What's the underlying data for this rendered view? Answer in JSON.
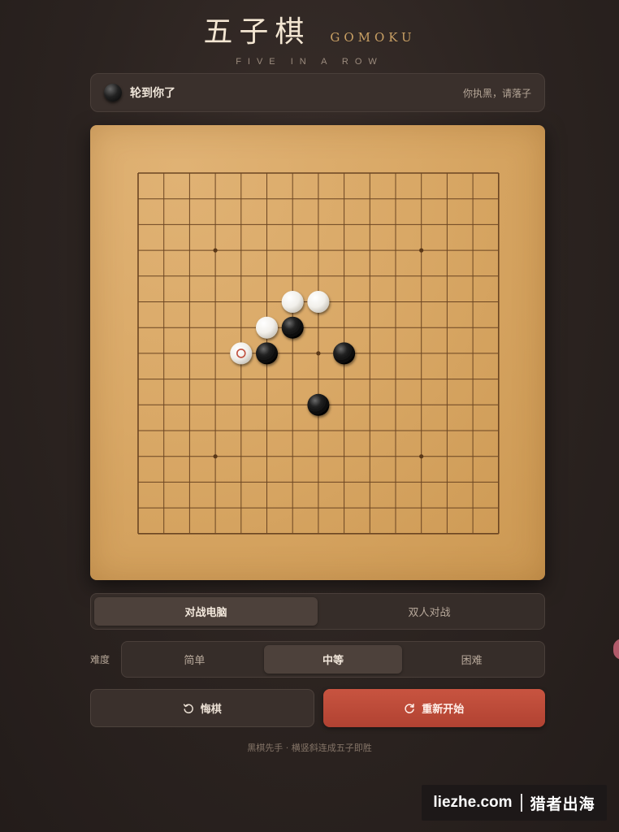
{
  "header": {
    "title_cn": "五子棋",
    "title_en": "GOMOKU",
    "subtitle": "FIVE IN A ROW"
  },
  "status": {
    "turn_text": "轮到你了",
    "hint": "你执黑，请落子",
    "current_stone": "black"
  },
  "board": {
    "size": 15,
    "star_points": [
      [
        3,
        3
      ],
      [
        11,
        3
      ],
      [
        7,
        7
      ],
      [
        3,
        11
      ],
      [
        11,
        11
      ]
    ],
    "stones": [
      {
        "col": 6,
        "row": 5,
        "color": "white"
      },
      {
        "col": 7,
        "row": 5,
        "color": "white"
      },
      {
        "col": 5,
        "row": 6,
        "color": "white"
      },
      {
        "col": 6,
        "row": 6,
        "color": "black"
      },
      {
        "col": 4,
        "row": 7,
        "color": "white",
        "last": true
      },
      {
        "col": 5,
        "row": 7,
        "color": "black"
      },
      {
        "col": 8,
        "row": 7,
        "color": "black"
      },
      {
        "col": 7,
        "row": 9,
        "color": "black"
      }
    ]
  },
  "modes": {
    "items": [
      "对战电脑",
      "双人对战"
    ],
    "selected": 0
  },
  "difficulty": {
    "label": "难度",
    "items": [
      "简单",
      "中等",
      "困难"
    ],
    "selected": 1
  },
  "actions": {
    "undo_label": "悔棋",
    "restart_label": "重新开始"
  },
  "footer": {
    "hint": "黑棋先手 · 横竖斜连成五子即胜"
  },
  "watermark": {
    "site": "liezhe.com",
    "brand": "猎者出海"
  },
  "colors": {
    "accent_red": "#c85440",
    "board_wood": "#d9a866",
    "title_gold": "#c9a064"
  }
}
